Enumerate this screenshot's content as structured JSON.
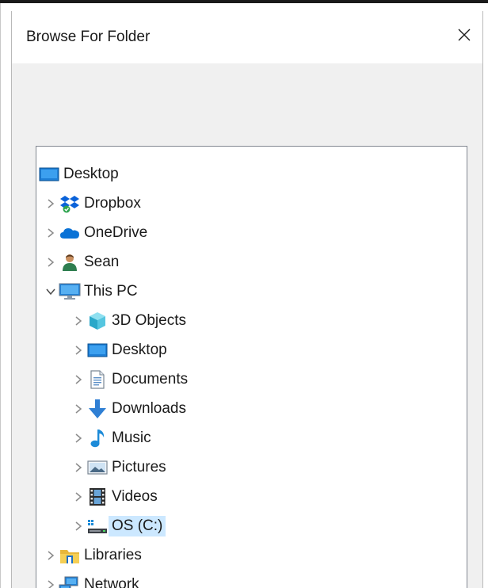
{
  "dialog": {
    "title": "Browse For Folder",
    "close_icon": "close-icon"
  },
  "tree": {
    "root": {
      "label": "Desktop",
      "icon": "desktop-icon"
    },
    "items": [
      {
        "label": "Dropbox",
        "icon": "dropbox-icon",
        "expanded": false
      },
      {
        "label": "OneDrive",
        "icon": "onedrive-icon",
        "expanded": false
      },
      {
        "label": "Sean",
        "icon": "user-icon",
        "expanded": false
      },
      {
        "label": "This PC",
        "icon": "computer-icon",
        "expanded": true
      }
    ],
    "this_pc_children": [
      {
        "label": "3D Objects",
        "icon": "3d-objects-icon"
      },
      {
        "label": "Desktop",
        "icon": "desktop-icon"
      },
      {
        "label": "Documents",
        "icon": "documents-icon"
      },
      {
        "label": "Downloads",
        "icon": "downloads-icon"
      },
      {
        "label": "Music",
        "icon": "music-icon"
      },
      {
        "label": "Pictures",
        "icon": "pictures-icon"
      },
      {
        "label": "Videos",
        "icon": "videos-icon"
      },
      {
        "label": "OS (C:)",
        "icon": "drive-icon",
        "selected": true
      }
    ],
    "after": [
      {
        "label": "Libraries",
        "icon": "libraries-icon"
      },
      {
        "label": "Network",
        "icon": "network-icon"
      }
    ]
  },
  "colors": {
    "selection": "#cce8ff",
    "tree_border": "#828790",
    "dialog_bg": "#f0f0f0"
  }
}
